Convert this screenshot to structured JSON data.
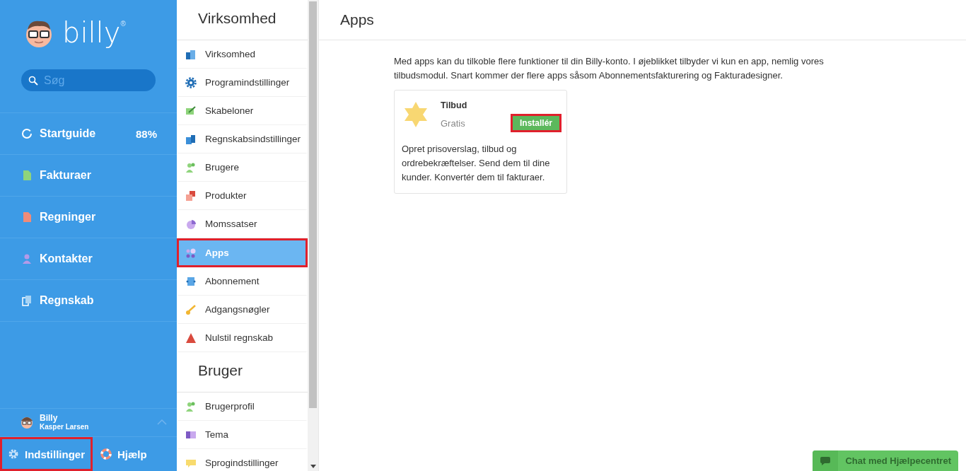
{
  "brand": {
    "name": "billy",
    "mark": "®"
  },
  "search": {
    "placeholder": "Søg"
  },
  "main_nav": [
    {
      "label": "Startguide",
      "badge": "88%"
    },
    {
      "label": "Fakturaer"
    },
    {
      "label": "Regninger"
    },
    {
      "label": "Kontakter"
    },
    {
      "label": "Regnskab"
    }
  ],
  "user": {
    "company": "Billy",
    "name": "Kasper Larsen"
  },
  "footer": [
    {
      "label": "Indstillinger",
      "highlighted": true
    },
    {
      "label": "Hjælp",
      "highlighted": false
    }
  ],
  "settings_sections": [
    {
      "title": "Virksomhed",
      "items": [
        {
          "label": "Virksomhed",
          "selected": false,
          "highlighted": false
        },
        {
          "label": "Programindstillinger",
          "selected": false,
          "highlighted": false
        },
        {
          "label": "Skabeloner",
          "selected": false,
          "highlighted": false
        },
        {
          "label": "Regnskabsindstillinger",
          "selected": false,
          "highlighted": false
        },
        {
          "label": "Brugere",
          "selected": false,
          "highlighted": false
        },
        {
          "label": "Produkter",
          "selected": false,
          "highlighted": false
        },
        {
          "label": "Momssatser",
          "selected": false,
          "highlighted": false
        },
        {
          "label": "Apps",
          "selected": true,
          "highlighted": true
        },
        {
          "label": "Abonnement",
          "selected": false,
          "highlighted": false
        },
        {
          "label": "Adgangsnøgler",
          "selected": false,
          "highlighted": false
        },
        {
          "label": "Nulstil regnskab",
          "selected": false,
          "highlighted": false
        }
      ]
    },
    {
      "title": "Bruger",
      "items": [
        {
          "label": "Brugerprofil",
          "selected": false,
          "highlighted": false
        },
        {
          "label": "Tema",
          "selected": false,
          "highlighted": false
        },
        {
          "label": "Sprogindstillinger",
          "selected": false,
          "highlighted": false
        }
      ]
    }
  ],
  "page": {
    "title": "Apps",
    "intro": "Med apps kan du tilkoble flere funktioner til din Billy-konto. I øjeblikket tilbyder vi kun en app, nemlig vores tilbudsmodul. Snart kommer der flere apps såsom Abonnementsfakturering og Fakturadesigner.",
    "apps": [
      {
        "name": "Tilbud",
        "price": "Gratis",
        "button": "Installér",
        "highlighted": true,
        "description": "Opret prisoverslag, tilbud og ordrebekræftelser. Send dem til dine kunder. Konvertér dem til fakturaer."
      }
    ]
  },
  "chat": {
    "label": "Chat med Hjælpecentret"
  }
}
